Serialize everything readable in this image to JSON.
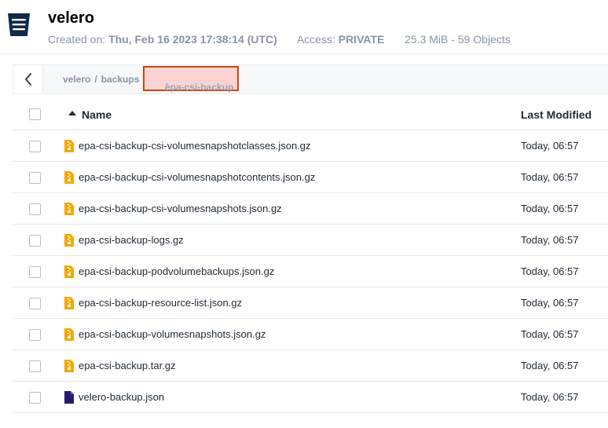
{
  "bucket": {
    "name": "velero",
    "created_label": "Created on:",
    "created_value": "Thu, Feb 16 2023 17:38:14 (UTC)",
    "access_label": "Access:",
    "access_value": "PRIVATE",
    "usage": "25.3 MiB - 59 Objects"
  },
  "breadcrumb": {
    "items": [
      "velero",
      "backups"
    ],
    "separator": "/",
    "current": "epa-csi-backup"
  },
  "table": {
    "columns": {
      "name": "Name",
      "last_modified": "Last Modified"
    },
    "rows": [
      {
        "name": "epa-csi-backup-csi-volumesnapshotclasses.json.gz",
        "modified": "Today, 06:57",
        "icon": "archive-file-icon"
      },
      {
        "name": "epa-csi-backup-csi-volumesnapshotcontents.json.gz",
        "modified": "Today, 06:57",
        "icon": "archive-file-icon"
      },
      {
        "name": "epa-csi-backup-csi-volumesnapshots.json.gz",
        "modified": "Today, 06:57",
        "icon": "archive-file-icon"
      },
      {
        "name": "epa-csi-backup-logs.gz",
        "modified": "Today, 06:57",
        "icon": "archive-file-icon"
      },
      {
        "name": "epa-csi-backup-podvolumebackups.json.gz",
        "modified": "Today, 06:57",
        "icon": "archive-file-icon"
      },
      {
        "name": "epa-csi-backup-resource-list.json.gz",
        "modified": "Today, 06:57",
        "icon": "archive-file-icon"
      },
      {
        "name": "epa-csi-backup-volumesnapshots.json.gz",
        "modified": "Today, 06:57",
        "icon": "archive-file-icon"
      },
      {
        "name": "epa-csi-backup.tar.gz",
        "modified": "Today, 06:57",
        "icon": "archive-file-icon"
      },
      {
        "name": "velero-backup.json",
        "modified": "Today, 06:57",
        "icon": "json-file-icon"
      }
    ]
  },
  "colors": {
    "archive_icon": "#f5a800",
    "json_icon": "#2b1a6b",
    "highlight_border": "#c8490f",
    "highlight_fill": "#fbd3d3",
    "muted_text": "#8a94a6"
  }
}
